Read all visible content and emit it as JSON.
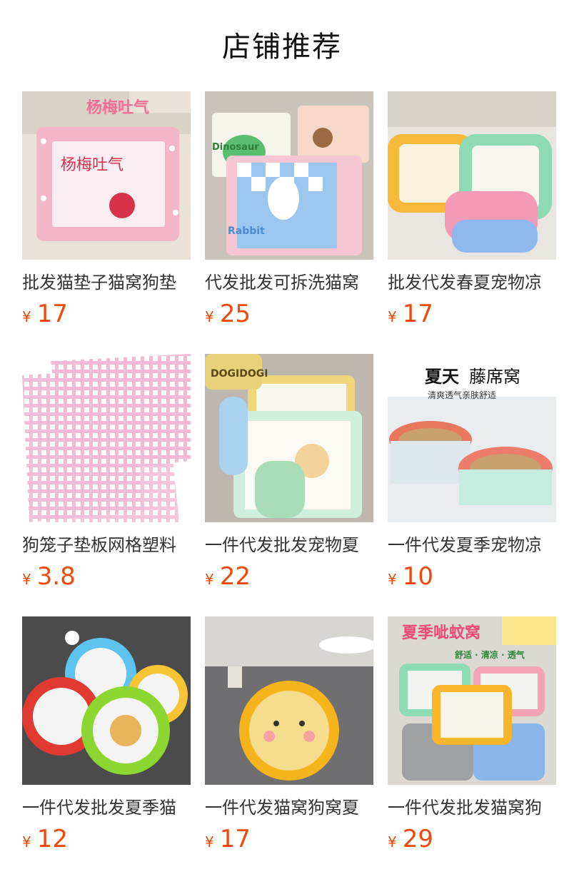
{
  "header": {
    "title": "店铺推荐"
  },
  "currency": "¥",
  "colors": {
    "price": "#f04a0a"
  },
  "products": [
    {
      "title": "批发猫垫子猫窝狗垫",
      "price": "17",
      "image_text": "杨梅吐气",
      "image_text2": "杨梅吐气"
    },
    {
      "title": "代发批发可拆洗猫窝",
      "price": "25",
      "image_text": "Dinosaur",
      "image_text2": "Rabbit"
    },
    {
      "title": "批发代发春夏宠物凉",
      "price": "17"
    },
    {
      "title": "狗笼子垫板网格塑料",
      "price": "3.8"
    },
    {
      "title": "一件代发批发宠物夏",
      "price": "22",
      "image_text": "DOGIDOGI"
    },
    {
      "title": "一件代发夏季宠物凉",
      "price": "10",
      "image_text": "夏天",
      "image_text2": "藤席窝",
      "image_text3": "清爽透气亲肤舒适"
    },
    {
      "title": "一件代发批发夏季猫",
      "price": "12"
    },
    {
      "title": "一件代发猫窝狗窝夏",
      "price": "17"
    },
    {
      "title": "一件代发批发猫窝狗",
      "price": "29",
      "image_text": "夏季呲蚊窝",
      "image_text2": "舒适 · 清凉 · 透气"
    }
  ]
}
